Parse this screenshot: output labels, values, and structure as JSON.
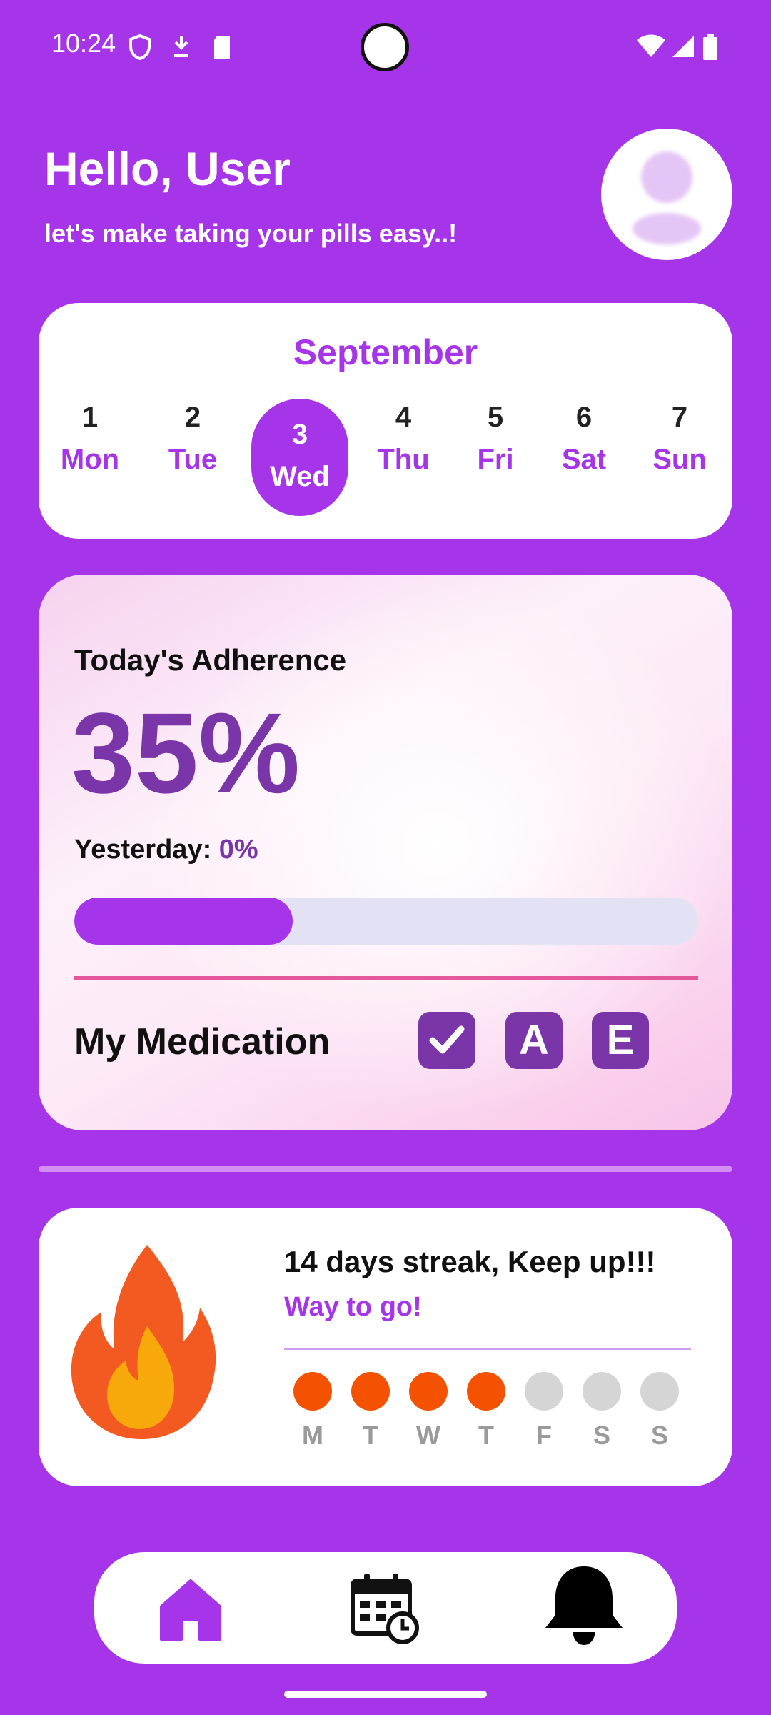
{
  "status_bar": {
    "time": "10:24"
  },
  "header": {
    "greeting": "Hello, User",
    "subtitle": "let's make taking your pills easy..!"
  },
  "calendar": {
    "month": "September",
    "days": [
      {
        "num": "1",
        "name": "Mon"
      },
      {
        "num": "2",
        "name": "Tue"
      },
      {
        "num": "3",
        "name": "Wed",
        "selected": true
      },
      {
        "num": "4",
        "name": "Thu"
      },
      {
        "num": "5",
        "name": "Fri"
      },
      {
        "num": "6",
        "name": "Sat"
      },
      {
        "num": "7",
        "name": "Sun"
      }
    ]
  },
  "adherence": {
    "title": "Today's Adherence",
    "percent_text": "35%",
    "progress_fraction": 0.35,
    "yesterday_label": "Yesterday:",
    "yesterday_value": "0%"
  },
  "medication": {
    "title": "My Medication",
    "icons": [
      {
        "name": "checkmark-icon",
        "glyph": "✓"
      },
      {
        "name": "letter-a-icon",
        "glyph": "A"
      },
      {
        "name": "letter-e-icon",
        "glyph": "E"
      }
    ]
  },
  "streak": {
    "title": "14 days streak, Keep up!!!",
    "subtitle": "Way to go!",
    "days": [
      {
        "label": "M",
        "done": true
      },
      {
        "label": "T",
        "done": true
      },
      {
        "label": "W",
        "done": true
      },
      {
        "label": "T",
        "done": true
      },
      {
        "label": "F",
        "done": false
      },
      {
        "label": "S",
        "done": false
      },
      {
        "label": "S",
        "done": false
      }
    ]
  },
  "nav": {
    "items": [
      "home-icon",
      "calendar-schedule-icon",
      "bell-icon"
    ]
  },
  "colors": {
    "background": "#a634e8",
    "accent_dark": "#7a36a8",
    "streak_on": "#f45100",
    "streak_off": "#d5d5d5"
  }
}
